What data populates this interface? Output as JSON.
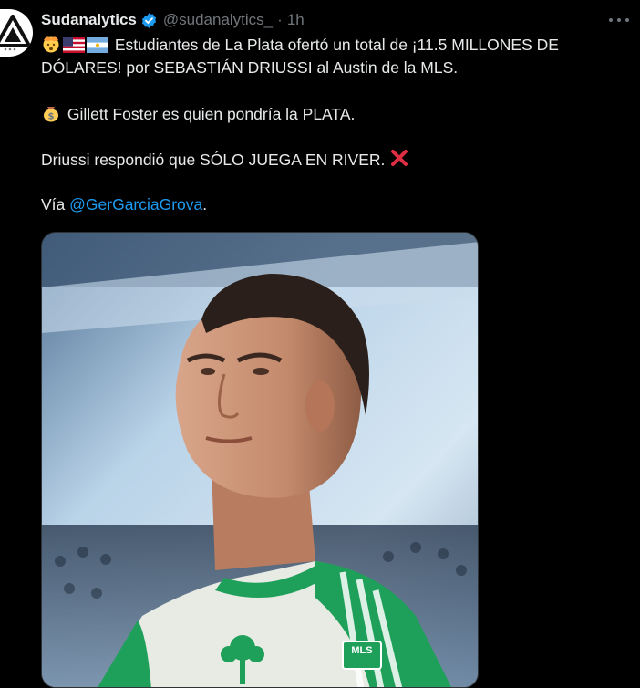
{
  "tweet": {
    "display_name": "Sudanalytics",
    "handle": "@sudanalytics_",
    "separator": "·",
    "time": "1h",
    "line1": "Estudiantes de La Plata ofertó un total de ¡11.5 MILLONES DE",
    "line2": "DÓLARES! por SEBASTIÁN DRIUSSI al Austin de la MLS.",
    "line3": "Gillett Foster es quien pondría la PLATA.",
    "line4": "Driussi respondió que SÓLO JUEGA EN RIVER.",
    "via_prefix": "Vía ",
    "mention": "@GerGarciaGrova",
    "via_suffix": "."
  },
  "media": {
    "alt": "Photo of player in green and white jersey",
    "badge_text": "MLS"
  },
  "icons": {
    "verified": "verified-badge-icon",
    "more": "more-options-icon",
    "line1_emojis": [
      "mind-blown-emoji",
      "us-flag-emoji",
      "argentina-flag-emoji"
    ],
    "line3_emoji": "money-bag-emoji",
    "line4_emoji": "cross-mark-emoji"
  },
  "colors": {
    "background": "#000000",
    "text": "#e7e9ea",
    "secondary": "#71767b",
    "link": "#1d9bf0",
    "verified": "#1d9bf0",
    "jersey_green": "#1fa05a"
  }
}
